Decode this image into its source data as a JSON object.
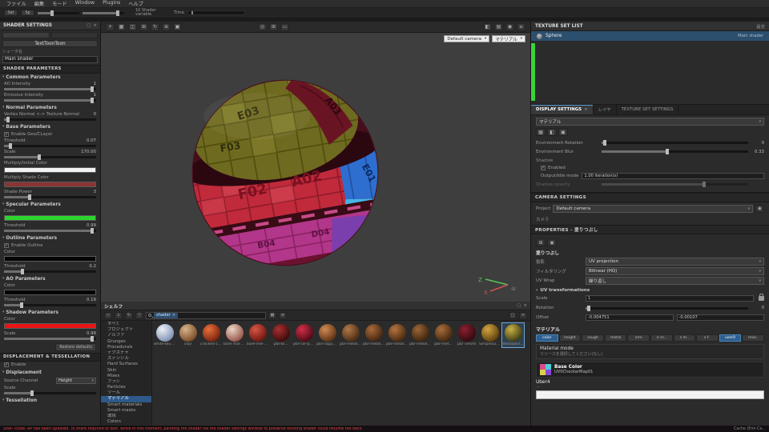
{
  "icons": {
    "caret": "▾",
    "close": "×",
    "check": "✓",
    "move": "+",
    "grid": "▦",
    "split": "◫",
    "frame": "⊞",
    "rotate": "↻",
    "target": "⊕",
    "cube": "▣",
    "orbit": "◎",
    "rect": "▭",
    "half": "◧",
    "rows": "▤",
    "dot": "◉",
    "menu": "≡",
    "folder": "▱",
    "down": "↓",
    "funnel": "▽",
    "window": "▢"
  },
  "menubar": {
    "items": [
      "ファイル",
      "編集",
      "モード",
      "Window",
      "Plugins",
      "ヘルプ"
    ]
  },
  "quickbar": {
    "btn1": "Set",
    "btn2": "Sp",
    "info": "10 Shader variable",
    "time_label": "Time"
  },
  "left_panel": {
    "title": "SHADER SETTINGS",
    "shader_button": "TextToonToon",
    "name_label": "シェーダ名",
    "name_value": "Main shader",
    "params_header": "SHADER PARAMETERS",
    "groups": [
      {
        "title": "Common Parameters",
        "params": [
          {
            "type": "slider",
            "label": "AO Intensity",
            "value": "1",
            "fill": 96
          },
          {
            "type": "slider",
            "label": "Emissive Intensity",
            "value": "1",
            "fill": 96
          }
        ]
      },
      {
        "title": "Normal Parameters",
        "params": [
          {
            "type": "slider",
            "label": "Vertex Normal <-> Texture Normal",
            "value": "0",
            "fill": 4
          }
        ]
      },
      {
        "title": "Base Parameters",
        "params": [
          {
            "type": "checkbox",
            "label": "Enable Geo/CLayer",
            "checked": true
          },
          {
            "type": "slider",
            "label": "Threshold",
            "value": "0.07",
            "fill": 7
          },
          {
            "type": "slider",
            "label": "Scale",
            "value": "170.00",
            "fill": 38
          },
          {
            "type": "swatch",
            "label": "Multiply/Initial Color",
            "color": "#f2f2f2"
          },
          {
            "type": "swatch",
            "label": "Multiply Shade Color",
            "color": "#8a3434"
          },
          {
            "type": "slider",
            "label": "Shade Power",
            "value": "3",
            "fill": 28
          }
        ]
      },
      {
        "title": "Specular Parameters",
        "params": [
          {
            "type": "swatch",
            "label": "Color",
            "color": "#2ed42e"
          },
          {
            "type": "slider",
            "label": "Threshold",
            "value": "0.99",
            "fill": 96
          }
        ]
      },
      {
        "title": "Outline Parameters",
        "params": [
          {
            "type": "checkbox",
            "label": "Enable Outline",
            "checked": true
          },
          {
            "type": "swatch",
            "label": "Color",
            "color": "#050505"
          },
          {
            "type": "slider",
            "label": "Threshold",
            "value": "0.2",
            "fill": 20
          }
        ]
      },
      {
        "title": "AO Parameters",
        "params": [
          {
            "type": "swatch",
            "label": "Color",
            "color": "#050505"
          },
          {
            "type": "slider",
            "label": "Threshold",
            "value": "0.19",
            "fill": 19
          }
        ]
      },
      {
        "title": "Shadow Parameters",
        "params": [
          {
            "type": "swatch",
            "label": "Color",
            "color": "#e81414"
          },
          {
            "type": "slider",
            "label": "Scale",
            "value": "0.99",
            "fill": 96
          },
          {
            "type": "button",
            "label": "Restore defaults"
          }
        ]
      },
      {
        "title": "DISPLACEMENT & TESSELLATION",
        "section": true,
        "params": [
          {
            "type": "checkbox",
            "label": "Enable",
            "checked": true
          }
        ]
      },
      {
        "title": "Displacement",
        "params": [
          {
            "type": "dropdown",
            "label": "Source Channel",
            "value": "Height"
          },
          {
            "type": "slider",
            "label": "Scale",
            "value": "",
            "fill": 30
          }
        ]
      },
      {
        "title": "Tessellation",
        "params": []
      }
    ]
  },
  "viewport": {
    "camera_dropdown": "Default camera",
    "mode_dropdown": "マテリアル",
    "labels": {
      "e03": "E03",
      "f03": "F03",
      "a03": "A03",
      "f02": "F02",
      "a02": "A02",
      "e01": "E01",
      "b04": "B04",
      "d04": "D04"
    },
    "axis": {
      "z": "Z",
      "x": "X",
      "u": "-U"
    }
  },
  "texture_set_list": {
    "title": "TEXTURE SET LIST",
    "action": "設定",
    "item_name": "Sphere",
    "item_shader": "Main shader"
  },
  "tabs": {
    "display": "DISPLAY SETTINGS",
    "layers": "レイヤ",
    "texture_set": "TEXTURE SET SETTINGS"
  },
  "display_settings": {
    "view_mode_value": "マテリアル",
    "env_rotation_label": "Environment Rotation",
    "env_rotation_value": "0",
    "env_blur_label": "Environment Blur",
    "env_blur_value": "0.33",
    "shadow_label": "Shadow",
    "enabled_label": "Enabled",
    "idle_label": "Output/Idle mode",
    "idle_value": "1.00 iteration(s)",
    "opacity_label": "Shadow opacity"
  },
  "camera_settings": {
    "title": "CAMERA SETTINGS",
    "project_label": "Project",
    "camera_value": "Default camera",
    "sub_tab": "カメラ"
  },
  "properties": {
    "title": "PROPERTIES - 塗りつぶし",
    "fill_title": "塗りつぶし",
    "projection_label": "投影",
    "projection_value": "UV projection",
    "filtering_label": "フィルタリング",
    "filtering_value": "Bilinear (HQ)",
    "uvwrap_label": "UV Wrap",
    "uvwrap_value": "繰り返し",
    "uv_title": "UV transformations",
    "scale_label": "Scale",
    "scale_value": "1",
    "rotation_label": "Rotation",
    "rotation_value": "0",
    "offset_label": "Offset",
    "offset_x": "-0.004751",
    "offset_y": "-0.00107",
    "material_title": "マテリアル",
    "channels": [
      "color",
      "height",
      "rough",
      "metal",
      "nrm",
      "e m..",
      "s m..",
      "s f..",
      "user0",
      "misc."
    ],
    "active_channels": [
      0,
      8
    ],
    "material_mode_label": "Material mode",
    "material_mode_hint": "リソースを選択してください(なし)",
    "base_color_label": "Base Color",
    "base_color_resource": "UV0CheckerMap01",
    "uber_label": "Uber4",
    "uber_hint": "..."
  },
  "shelf": {
    "title": "シェルフ",
    "search_chip": "shader",
    "tree": [
      "すべて",
      "プロジェクト",
      "アルファ",
      "Grunges",
      "Procedurals",
      "テクスチャ",
      "ステンシル",
      "Hard Surfaces",
      "Skin",
      "Mixes",
      "ブラシ",
      "Particles",
      "ツール",
      "マテリアル",
      "Smart materials",
      "Smart masks",
      "環境",
      "Colors"
    ],
    "selected_tree_index": 13,
    "selected_thumb_index": 15,
    "thumbs": [
      {
        "label": "white-blue-...",
        "c1": "#eef1f6",
        "c2": "#7f93b5"
      },
      {
        "label": "clay",
        "c1": "#d9b38a",
        "c2": "#7a4e28"
      },
      {
        "label": "cracked clay",
        "c1": "#e8703a",
        "c2": "#7a240e"
      },
      {
        "label": "bare marble",
        "c1": "#e8d6c4",
        "c2": "#9a564c"
      },
      {
        "label": "bare-red-cl...",
        "c1": "#d85545",
        "c2": "#6e1810"
      },
      {
        "label": "pbr-bl...",
        "c1": "#a83030",
        "c2": "#3c0b0b"
      },
      {
        "label": "pbr-car-paint",
        "c1": "#d03048",
        "c2": "#500a16"
      },
      {
        "label": "pbr-copper...",
        "c1": "#d08a50",
        "c2": "#5e3317"
      },
      {
        "label": "pbr-metal-c...",
        "c1": "#b07848",
        "c2": "#4a2c15"
      },
      {
        "label": "pbr-metal-r...",
        "c1": "#aa6a3a",
        "c2": "#422510"
      },
      {
        "label": "pbr-metal-r...",
        "c1": "#b5743f",
        "c2": "#482a12"
      },
      {
        "label": "pbr-metal-s...",
        "c1": "#9a6535",
        "c2": "#3e240e"
      },
      {
        "label": "pbr-met...",
        "c1": "#a86e3c",
        "c2": "#442710"
      },
      {
        "label": "pbr velvet",
        "c1": "#8a2030",
        "c2": "#330910"
      },
      {
        "label": "SimpleLUT20",
        "c1": "#d4a440",
        "c2": "#5e430e"
      },
      {
        "label": "TextToonToon",
        "c1": "#c8b244",
        "c2": "#3e3c16"
      }
    ]
  },
  "status_bar": {
    "message": "Shell Tcode: AP has been updated. To share required to Bolt. While in this moment, painting the shader via the shader settings window to preserve existing shader could resume the deco",
    "right": "Cache (Enh-Ce..."
  }
}
